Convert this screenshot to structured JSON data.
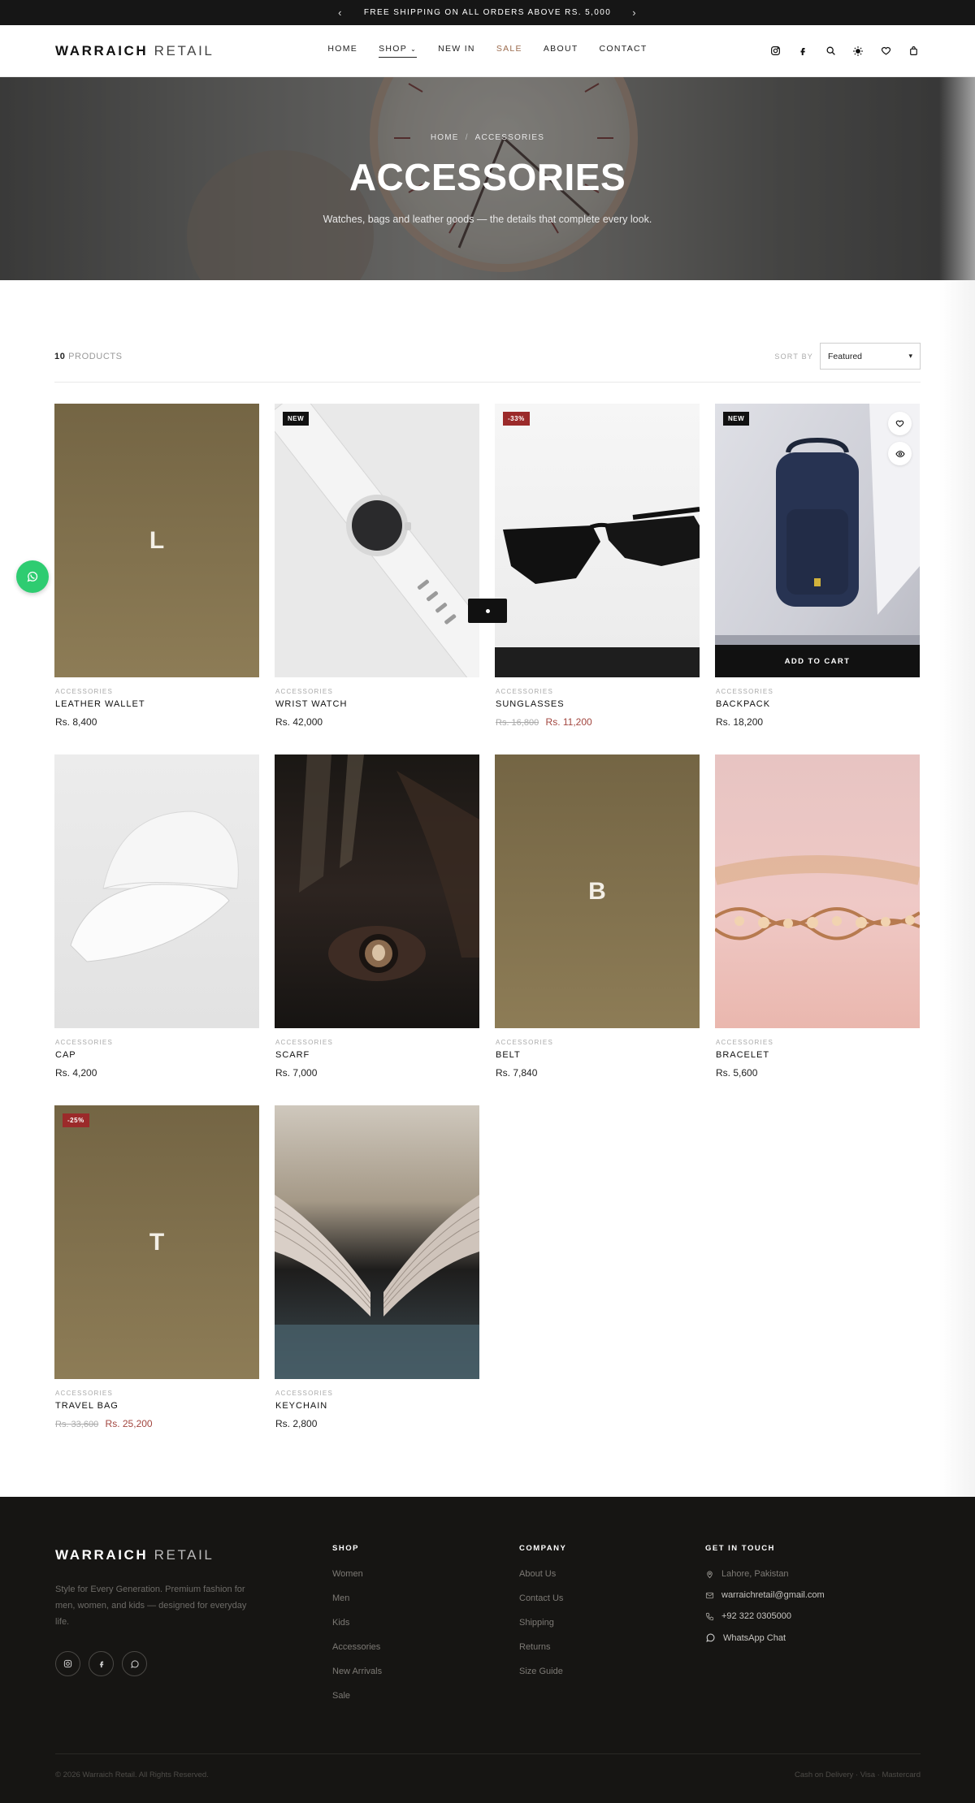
{
  "announcement": {
    "text": "FREE SHIPPING ON ALL ORDERS ABOVE RS. 5,000",
    "prev_icon": "chevron-left-icon",
    "next_icon": "chevron-right-icon"
  },
  "header": {
    "logo_bold": "WARRAICH",
    "logo_light": "RETAIL",
    "nav": [
      {
        "label": "HOME"
      },
      {
        "label": "SHOP"
      },
      {
        "label": "NEW IN"
      },
      {
        "label": "SALE"
      },
      {
        "label": "ABOUT"
      },
      {
        "label": "CONTACT"
      }
    ],
    "icons": [
      "instagram-icon",
      "facebook-icon",
      "search-icon",
      "theme-toggle-icon",
      "wishlist-icon",
      "bag-icon"
    ]
  },
  "hero": {
    "breadcrumb_home": "HOME",
    "breadcrumb_sep": "/",
    "breadcrumb_current": "ACCESSORIES",
    "title": "ACCESSORIES",
    "subtitle": "Watches, bags and leather goods — the details that complete every look."
  },
  "toolbar": {
    "count_number": "10",
    "count_label": "PRODUCTS",
    "sort_label": "SORT BY",
    "sort_value": "Featured"
  },
  "products": [
    {
      "category": "ACCESSORIES",
      "name": "LEATHER WALLET",
      "price": "Rs. 8,400",
      "old_price": "",
      "placeholder_letter": "L",
      "badge": ""
    },
    {
      "category": "ACCESSORIES",
      "name": "WRIST WATCH",
      "price": "Rs. 42,000",
      "old_price": "",
      "badge": "NEW"
    },
    {
      "category": "ACCESSORIES",
      "name": "SUNGLASSES",
      "price": "Rs. 11,200",
      "old_price": "Rs. 16,800",
      "badge": "-33%"
    },
    {
      "category": "ACCESSORIES",
      "name": "BACKPACK",
      "price": "Rs. 18,200",
      "old_price": "",
      "badge": "NEW",
      "action": "ADD TO CART"
    },
    {
      "category": "ACCESSORIES",
      "name": "CAP",
      "price": "Rs. 4,200",
      "old_price": "",
      "badge": ""
    },
    {
      "category": "ACCESSORIES",
      "name": "SCARF",
      "price": "Rs. 7,000",
      "old_price": "",
      "badge": ""
    },
    {
      "category": "ACCESSORIES",
      "name": "BELT",
      "price": "Rs. 7,840",
      "old_price": "",
      "placeholder_letter": "B",
      "badge": ""
    },
    {
      "category": "ACCESSORIES",
      "name": "BRACELET",
      "price": "Rs. 5,600",
      "old_price": "",
      "badge": ""
    },
    {
      "category": "ACCESSORIES",
      "name": "TRAVEL BAG",
      "price": "Rs. 25,200",
      "old_price": "Rs. 33,600",
      "placeholder_letter": "T",
      "badge": "-25%"
    },
    {
      "category": "ACCESSORIES",
      "name": "KEYCHAIN",
      "price": "Rs. 2,800",
      "old_price": "",
      "badge": ""
    }
  ],
  "footer": {
    "logo_bold": "WARRAICH",
    "logo_light": "RETAIL",
    "tagline": "Style for Every Generation. Premium fashion for men, women, and kids — designed for everyday life.",
    "shop_title": "SHOP",
    "shop_links": [
      "Women",
      "Men",
      "Kids",
      "Accessories",
      "New Arrivals",
      "Sale"
    ],
    "company_title": "COMPANY",
    "company_links": [
      "About Us",
      "Contact Us",
      "Shipping",
      "Returns",
      "Size Guide"
    ],
    "contact_title": "GET IN TOUCH",
    "contact": {
      "location": "Lahore, Pakistan",
      "email": "warraichretail@gmail.com",
      "phone": "+92 322 0305000",
      "whatsapp": "WhatsApp Chat"
    },
    "copyright": "© 2026 Warraich Retail. All Rights Reserved.",
    "payments": "Cash on Delivery · Visa · Mastercard"
  },
  "colors": {
    "accent_sale": "#9b6b4d",
    "discount_badge": "#9b2a2a",
    "whatsapp": "#2ecc71",
    "footer_bg": "#161513"
  }
}
